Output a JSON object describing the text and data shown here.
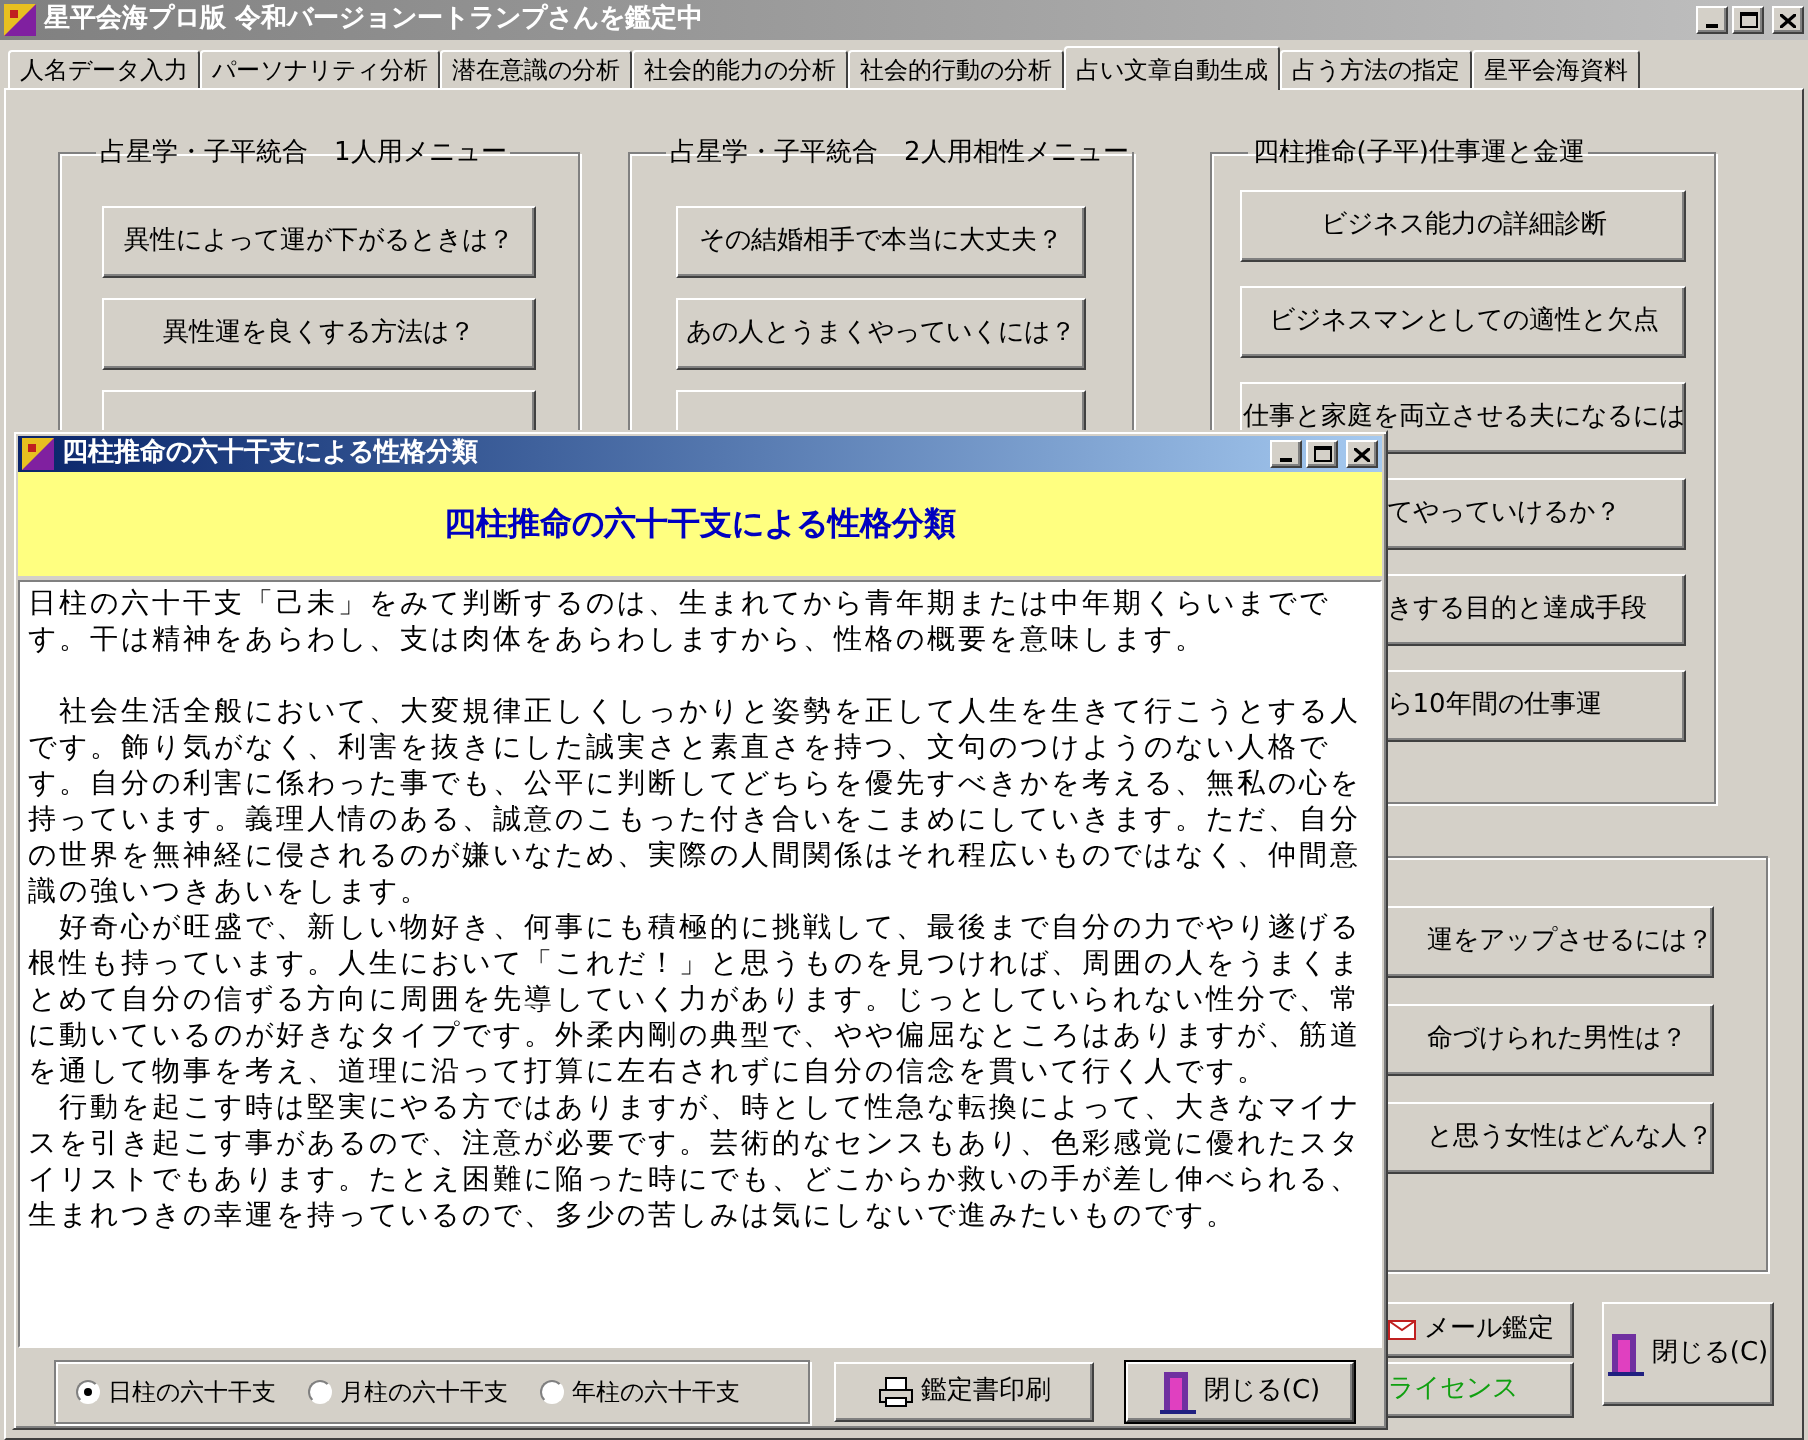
{
  "main_window": {
    "title": "星平会海プロ版 令和バージョンートランプさんを鑑定中",
    "tabs": [
      {
        "label": "人名データ入力",
        "selected": false
      },
      {
        "label": "パーソナリティ分析",
        "selected": false
      },
      {
        "label": "潜在意識の分析",
        "selected": false
      },
      {
        "label": "社会的能力の分析",
        "selected": false
      },
      {
        "label": "社会的行動の分析",
        "selected": false
      },
      {
        "label": "占い文章自動生成",
        "selected": true
      },
      {
        "label": "占う方法の指定",
        "selected": false
      },
      {
        "label": "星平会海資料",
        "selected": false
      }
    ],
    "groups": [
      {
        "title": "占星学・子平統合　1人用メニュー",
        "buttons": [
          {
            "label": "異性によって運が下がるときは？",
            "kind": "full"
          },
          {
            "label": "異性運を良くする方法は？",
            "kind": "full"
          },
          {
            "kind": "hidden"
          }
        ]
      },
      {
        "title": "占星学・子平統合　2人用相性メニュー",
        "buttons": [
          {
            "label": "その結婚相手で本当に大丈夫？",
            "kind": "full"
          },
          {
            "label": "あの人とうまくやっていくには？",
            "kind": "full"
          },
          {
            "kind": "hidden"
          }
        ]
      },
      {
        "title": "四柱推命(子平)仕事運と金運",
        "buttons": [
          {
            "label": "ビジネス能力の詳細診断",
            "kind": "full"
          },
          {
            "label": "ビジネスマンとしての適性と欠点",
            "kind": "full"
          },
          {
            "label": "仕事と家庭を両立させる夫になるには",
            "kind": "full"
          },
          {
            "label": "てやっていけるか？",
            "kind": "clipped"
          },
          {
            "label": "きする目的と達成手段",
            "kind": "clipped"
          },
          {
            "label": "ら10年間の仕事運",
            "kind": "clipped"
          }
        ]
      },
      {
        "buttons": [
          {
            "label": "運をアップさせるには？",
            "kind": "clipped"
          },
          {
            "label": "命づけられた男性は？",
            "kind": "clipped"
          },
          {
            "label": "と思う女性はどんな人？",
            "kind": "clipped"
          }
        ]
      }
    ],
    "mail_button": "メール鑑定",
    "license_button": "ライセンス",
    "close_button": "閉じる(C)"
  },
  "dialog": {
    "title": "四柱推命の六十干支による性格分類",
    "heading": "四柱推命の六十干支による性格分類",
    "paragraphs": [
      {
        "kind": "lead",
        "text": "日柱の六十干支「己未」をみて判断するのは、生まれてから青年期または中年期くらいまでです。干は精神をあらわし、支は肉体をあらわしますから、性格の概要を意味します。"
      },
      {
        "kind": "body",
        "text": "　社会生活全般において、大変規律正しくしっかりと姿勢を正して人生を生きて行こうとする人です。飾り気がなく、利害を抜きにした誠実さと素直さを持つ、文句のつけようのない人格です。自分の利害に係わった事でも、公平に判断してどちらを優先すべきかを考える、無私の心を持っています。義理人情のある、誠意のこもった付き合いをこまめにしていきます。ただ、自分の世界を無神経に侵されるのが嫌いなため、実際の人間関係はそれ程広いものではなく、仲間意識の強いつきあいをします。"
      },
      {
        "kind": "body",
        "text": "　好奇心が旺盛で、新しい物好き、何事にも積極的に挑戦して、最後まで自分の力でやり遂げる根性も持っています。人生において「これだ！」と思うものを見つければ、周囲の人をうまくまとめて自分の信ずる方向に周囲を先導していく力があります。じっとしていられない性分で、常に動いているのが好きなタイプです。外柔内剛の典型で、やや偏屈なところはありますが、筋道を通して物事を考え、道理に沿って打算に左右されずに自分の信念を貫いて行く人です。"
      },
      {
        "kind": "body",
        "text": "　行動を起こす時は堅実にやる方ではありますが、時として性急な転換によって、大きなマイナスを引き起こす事があるので、注意が必要です。芸術的なセンスもあり、色彩感覚に優れたスタイリストでもあります。たとえ困難に陥った時にでも、どこからか救いの手が差し伸べられる、生まれつきの幸運を持っているので、多少の苦しみは気にしないで進みたいものです。"
      }
    ],
    "radios": [
      {
        "label": "日柱の六十干支",
        "selected": true
      },
      {
        "label": "月柱の六十干支",
        "selected": false
      },
      {
        "label": "年柱の六十干支",
        "selected": false
      }
    ],
    "print_button": "鑑定書印刷",
    "close_button": "閉じる(C)"
  }
}
